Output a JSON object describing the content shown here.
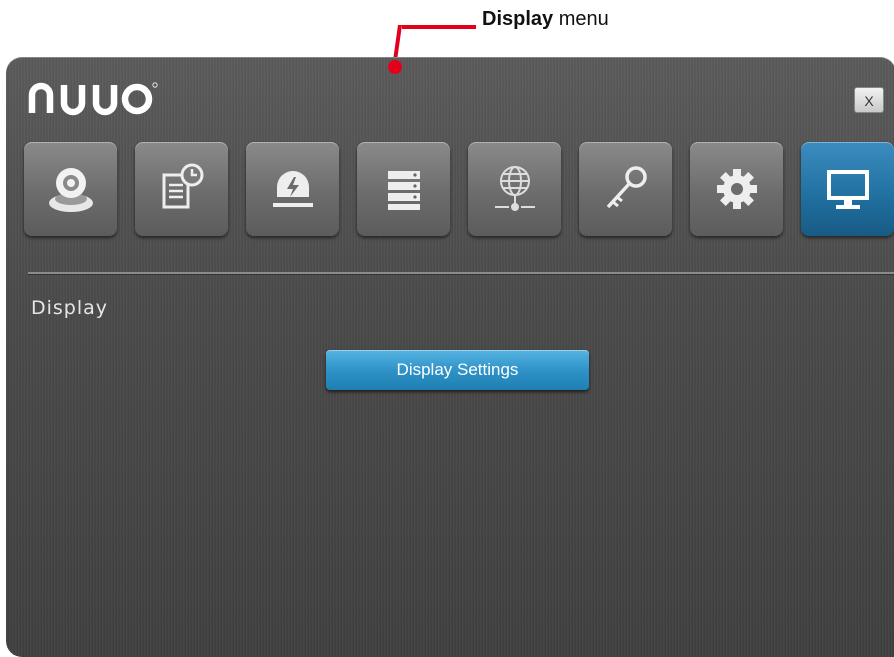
{
  "callout": {
    "bold": "Display",
    "rest": " menu",
    "color": "#e3001b"
  },
  "window": {
    "logo_text": "NUUO",
    "close_label": "X",
    "tabs": [
      {
        "icon": "camera-icon"
      },
      {
        "icon": "schedule-log-icon"
      },
      {
        "icon": "alarm-icon"
      },
      {
        "icon": "storage-icon"
      },
      {
        "icon": "network-icon"
      },
      {
        "icon": "key-icon"
      },
      {
        "icon": "gear-icon"
      },
      {
        "icon": "monitor-icon",
        "active": true
      }
    ],
    "section_title": "Display",
    "display_button_label": "Display Settings",
    "accent_color": "#2f93c8"
  }
}
